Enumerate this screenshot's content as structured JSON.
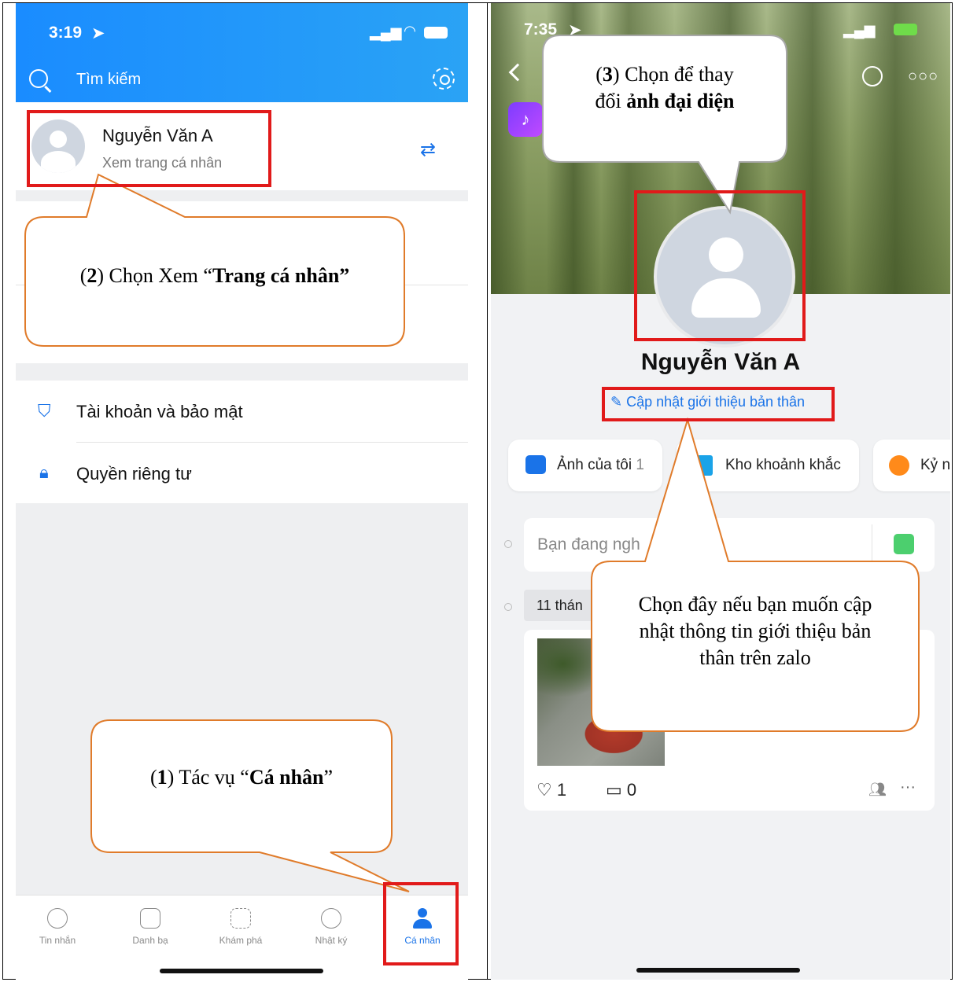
{
  "left": {
    "status_time": "3:19",
    "search_placeholder": "Tìm kiếm",
    "profile": {
      "name": "Nguyễn Văn A",
      "subtitle": "Xem trang cá nhân"
    },
    "menu": [
      {
        "label": "Tài khoản và bảo mật",
        "icon": "shield-icon"
      },
      {
        "label": "Quyền riêng tư",
        "icon": "lock-icon"
      }
    ],
    "tabs": [
      {
        "label": "Tin nhắn",
        "icon": "chat-icon"
      },
      {
        "label": "Danh bạ",
        "icon": "contacts-icon"
      },
      {
        "label": "Khám phá",
        "icon": "grid-icon"
      },
      {
        "label": "Nhật ký",
        "icon": "clock-icon"
      },
      {
        "label": "Cá nhân",
        "icon": "person-icon",
        "active": true
      }
    ]
  },
  "right": {
    "status_time": "7:35",
    "name": "Nguyễn Văn A",
    "update_intro": "Cập nhật giới thiệu bản thân",
    "pills": [
      {
        "label": "Ảnh của tôi",
        "count": "1"
      },
      {
        "label": "Kho khoảnh khắc"
      },
      {
        "label": "Kỷ n"
      }
    ],
    "composer_placeholder": "Bạn đang ngh",
    "date_chip": "11 thán",
    "likes": "1",
    "comments": "0",
    "more": "···"
  },
  "callouts": {
    "c1_pre": "(",
    "c1_num": "1",
    "c1_mid": ") Tác vụ “",
    "c1_bold": "Cá nhân",
    "c1_post": "”",
    "c2_pre": "(",
    "c2_num": "2",
    "c2_mid": ") Chọn Xem “",
    "c2_bold": "Trang cá nhân”",
    "c3_pre": "(",
    "c3_num": "3",
    "c3_mid": ") Chọn để thay",
    "c3_line2_pre": "đổi ",
    "c3_bold": "ảnh đại diện",
    "c4": "Chọn đây nếu bạn muốn cập nhật thông tin giới thiệu bản thân  trên zalo"
  },
  "colors": {
    "brand": "#1a8cff",
    "highlight": "#e11a1a",
    "callout_border": "#e07b2a"
  }
}
